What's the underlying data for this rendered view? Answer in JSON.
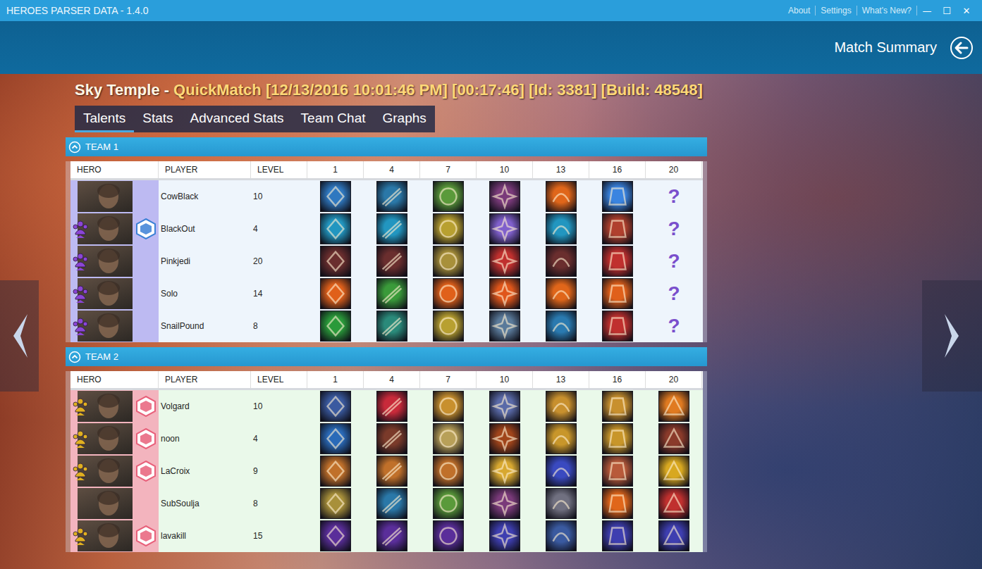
{
  "window": {
    "title": "HEROES PARSER DATA - 1.4.0",
    "menu": [
      "About",
      "Settings",
      "What's New?"
    ],
    "controls": [
      "—",
      "☐",
      "✕"
    ]
  },
  "header": {
    "title": "Match Summary"
  },
  "match": {
    "map": "Sky Temple -",
    "details": "QuickMatch [12/13/2016 10:01:46 PM] [00:17:46] [Id: 3381] [Build: 48548]"
  },
  "tabs": [
    {
      "label": "Talents",
      "selected": true
    },
    {
      "label": "Stats",
      "selected": false
    },
    {
      "label": "Advanced Stats",
      "selected": false
    },
    {
      "label": "Team Chat",
      "selected": false
    },
    {
      "label": "Graphs",
      "selected": false
    }
  ],
  "columns": [
    "HERO",
    "PLAYER",
    "LEVEL",
    "1",
    "4",
    "7",
    "10",
    "13",
    "16",
    "20"
  ],
  "teams": [
    {
      "name": "TEAM 1",
      "expanded": true,
      "row_color": "#eef5fc",
      "accent_color": "#bdbaf2",
      "party_color": "#8b45d6",
      "badge_color": "#3b80d6",
      "players": [
        {
          "player": "CowBlack",
          "level": "10",
          "in_party": false,
          "role_badge": false,
          "talents": [
            {
              "kind": "icon",
              "color": "#2f78c0"
            },
            {
              "kind": "icon",
              "color": "#2a78a8"
            },
            {
              "kind": "icon",
              "color": "#5a9a3a"
            },
            {
              "kind": "icon",
              "color": "#7a3a7a"
            },
            {
              "kind": "icon",
              "color": "#e0661a"
            },
            {
              "kind": "icon",
              "color": "#3a84e0"
            },
            {
              "kind": "unknown",
              "label": "?"
            }
          ]
        },
        {
          "player": "BlackOut",
          "level": "4",
          "in_party": true,
          "role_badge": true,
          "talents": [
            {
              "kind": "icon",
              "color": "#2296c0"
            },
            {
              "kind": "icon",
              "color": "#2296c0"
            },
            {
              "kind": "icon",
              "color": "#b8a030"
            },
            {
              "kind": "icon",
              "color": "#8060cc"
            },
            {
              "kind": "icon",
              "color": "#2296c0"
            },
            {
              "kind": "icon",
              "color": "#b0402e"
            },
            {
              "kind": "unknown",
              "label": "?"
            }
          ]
        },
        {
          "player": "Pinkjedi",
          "level": "20",
          "in_party": true,
          "role_badge": false,
          "talents": [
            {
              "kind": "icon",
              "color": "#6a2e2e"
            },
            {
              "kind": "icon",
              "color": "#6a2e2e"
            },
            {
              "kind": "icon",
              "color": "#a8903a"
            },
            {
              "kind": "icon",
              "color": "#c0302e"
            },
            {
              "kind": "icon",
              "color": "#6a2e2e"
            },
            {
              "kind": "icon",
              "color": "#c0302e"
            },
            {
              "kind": "unknown",
              "label": "?"
            }
          ]
        },
        {
          "player": "Solo",
          "level": "14",
          "in_party": true,
          "role_badge": false,
          "talents": [
            {
              "kind": "icon",
              "color": "#e0601a"
            },
            {
              "kind": "icon",
              "color": "#3a9a3a"
            },
            {
              "kind": "icon",
              "color": "#e0601a"
            },
            {
              "kind": "icon",
              "color": "#e0561a"
            },
            {
              "kind": "icon",
              "color": "#e0661a"
            },
            {
              "kind": "icon",
              "color": "#e0601a"
            },
            {
              "kind": "unknown",
              "label": "?"
            }
          ]
        },
        {
          "player": "SnailPound",
          "level": "8",
          "in_party": true,
          "role_badge": false,
          "talents": [
            {
              "kind": "icon",
              "color": "#2a9a3a"
            },
            {
              "kind": "icon",
              "color": "#2a8a7a"
            },
            {
              "kind": "icon",
              "color": "#b8a030"
            },
            {
              "kind": "icon",
              "color": "#5a7a9a"
            },
            {
              "kind": "icon",
              "color": "#2a7ab0"
            },
            {
              "kind": "icon",
              "color": "#c0302e"
            },
            {
              "kind": "unknown",
              "label": "?"
            }
          ]
        }
      ]
    },
    {
      "name": "TEAM 2",
      "expanded": true,
      "row_color": "#eaf9ea",
      "accent_color": "#f3b4be",
      "party_color": "#e0b020",
      "badge_color": "#e8607a",
      "players": [
        {
          "player": "Volgard",
          "level": "10",
          "in_party": true,
          "role_badge": true,
          "talents": [
            {
              "kind": "icon",
              "color": "#3a5aa0"
            },
            {
              "kind": "icon",
              "color": "#c82a3a"
            },
            {
              "kind": "icon",
              "color": "#c8902e"
            },
            {
              "kind": "icon",
              "color": "#5a6aa8"
            },
            {
              "kind": "icon",
              "color": "#c8902e"
            },
            {
              "kind": "icon",
              "color": "#c8902e"
            },
            {
              "kind": "icon",
              "color": "#e07a20"
            }
          ]
        },
        {
          "player": "noon",
          "level": "4",
          "in_party": true,
          "role_badge": true,
          "talents": [
            {
              "kind": "icon",
              "color": "#2a6ab8"
            },
            {
              "kind": "icon",
              "color": "#7a3a2a"
            },
            {
              "kind": "icon",
              "color": "#b8a058"
            },
            {
              "kind": "icon",
              "color": "#a0441a"
            },
            {
              "kind": "icon",
              "color": "#c8962a"
            },
            {
              "kind": "icon",
              "color": "#c8962a"
            },
            {
              "kind": "icon",
              "color": "#8a3a2a"
            }
          ]
        },
        {
          "player": "LaCroix",
          "level": "9",
          "in_party": true,
          "role_badge": true,
          "talents": [
            {
              "kind": "icon",
              "color": "#c0702a"
            },
            {
              "kind": "icon",
              "color": "#c0702a"
            },
            {
              "kind": "icon",
              "color": "#c0702a"
            },
            {
              "kind": "icon",
              "color": "#d8a830"
            },
            {
              "kind": "icon",
              "color": "#3a4ac0"
            },
            {
              "kind": "icon",
              "color": "#b85a3a"
            },
            {
              "kind": "icon",
              "color": "#d8a820"
            }
          ]
        },
        {
          "player": "SubSoulja",
          "level": "8",
          "in_party": false,
          "role_badge": false,
          "talents": [
            {
              "kind": "icon",
              "color": "#a8903a"
            },
            {
              "kind": "icon",
              "color": "#2a78a8"
            },
            {
              "kind": "icon",
              "color": "#5a9a3a"
            },
            {
              "kind": "icon",
              "color": "#7a3a7a"
            },
            {
              "kind": "icon",
              "color": "#707080"
            },
            {
              "kind": "icon",
              "color": "#e0661a"
            },
            {
              "kind": "icon",
              "color": "#c0302e"
            }
          ]
        },
        {
          "player": "lavakill",
          "level": "15",
          "in_party": true,
          "role_badge": true,
          "talents": [
            {
              "kind": "icon",
              "color": "#5a2e9a"
            },
            {
              "kind": "icon",
              "color": "#5a2e9a"
            },
            {
              "kind": "icon",
              "color": "#5a2e9a"
            },
            {
              "kind": "icon",
              "color": "#3e3eb0"
            },
            {
              "kind": "icon",
              "color": "#3a5aa0"
            },
            {
              "kind": "icon",
              "color": "#3e3eb0"
            },
            {
              "kind": "icon",
              "color": "#3e3eb0"
            }
          ]
        }
      ]
    }
  ]
}
